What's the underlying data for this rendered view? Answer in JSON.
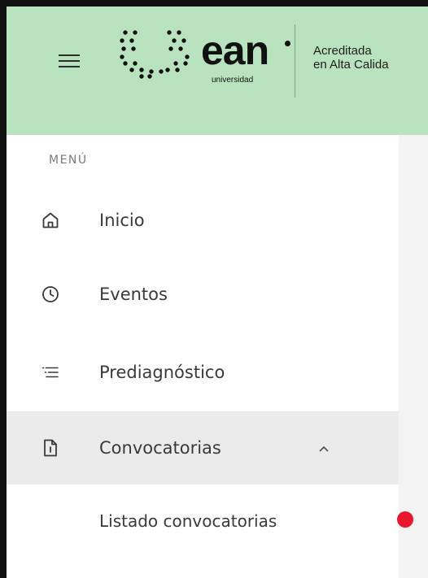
{
  "header": {
    "logo": {
      "wordmark": "ean",
      "subtitle": "universidad"
    },
    "accreditation": {
      "line1": "Acreditada",
      "line2": "en Alta Calida"
    }
  },
  "sidebar": {
    "menu_title": "MENÚ",
    "items": [
      {
        "label": "Inicio",
        "icon": "home-icon",
        "active": false
      },
      {
        "label": "Eventos",
        "icon": "clock-icon",
        "active": false
      },
      {
        "label": "Prediagnóstico",
        "icon": "list-icon",
        "active": false
      },
      {
        "label": "Convocatorias",
        "icon": "document-icon",
        "active": true,
        "expanded": true,
        "subitems": [
          {
            "label": "Listado convocatorias"
          }
        ]
      }
    ]
  },
  "colors": {
    "header_bg": "#b9e3bf",
    "active_item_bg": "#ebebeb",
    "notification_dot": "#e8172d",
    "text": "#3a3a3a"
  }
}
